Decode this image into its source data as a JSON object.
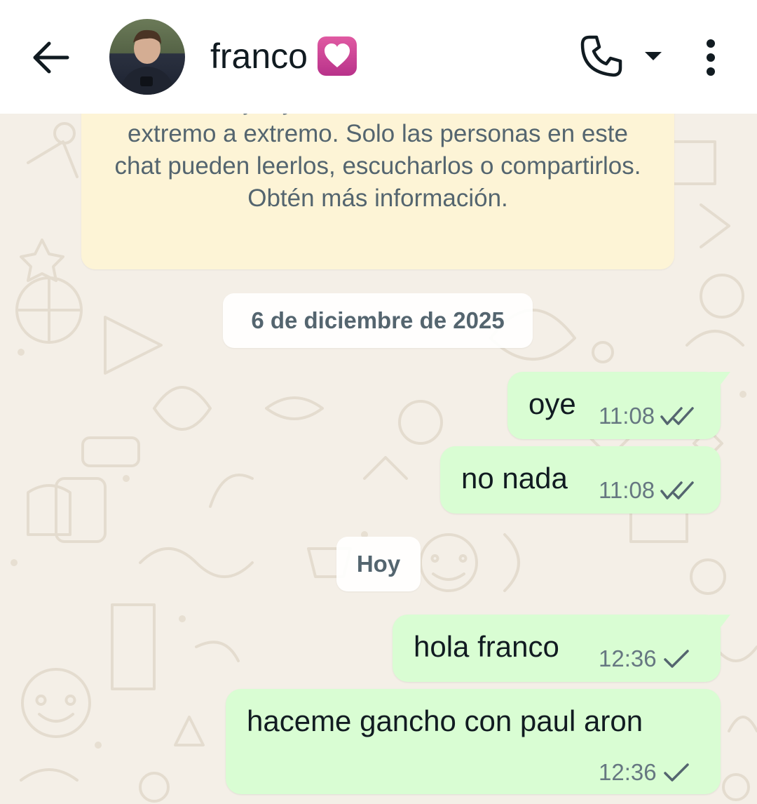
{
  "header": {
    "contact_name": "franco",
    "name_emoji": "heart-icon",
    "icons": [
      "back-arrow-icon",
      "phone-icon",
      "caret-down-icon",
      "more-vert-icon"
    ]
  },
  "chat": {
    "encryption_notice": "Los mensajes y las llamadas están cifrados de extremo a extremo. Solo las personas en este chat pueden leerlos, escucharlos o compartirlos. Obtén más información.",
    "date_chips": [
      "6 de diciembre de 2025",
      "Hoy"
    ],
    "messages": [
      {
        "text": "oye",
        "time": "11:08",
        "status": "read"
      },
      {
        "text": "no nada",
        "time": "11:08",
        "status": "read"
      },
      {
        "text": "hola franco",
        "time": "12:36",
        "status": "sent"
      },
      {
        "text": "haceme gancho con paul aron",
        "time": "12:36",
        "status": "sent"
      }
    ]
  },
  "colors": {
    "header_bg": "#ffffff",
    "chat_bg": "#f4efe7",
    "outgoing_bubble": "#d9fdd3",
    "notice_bg": "#fdf4d6",
    "text_primary": "#111b21",
    "text_secondary": "#667781"
  }
}
